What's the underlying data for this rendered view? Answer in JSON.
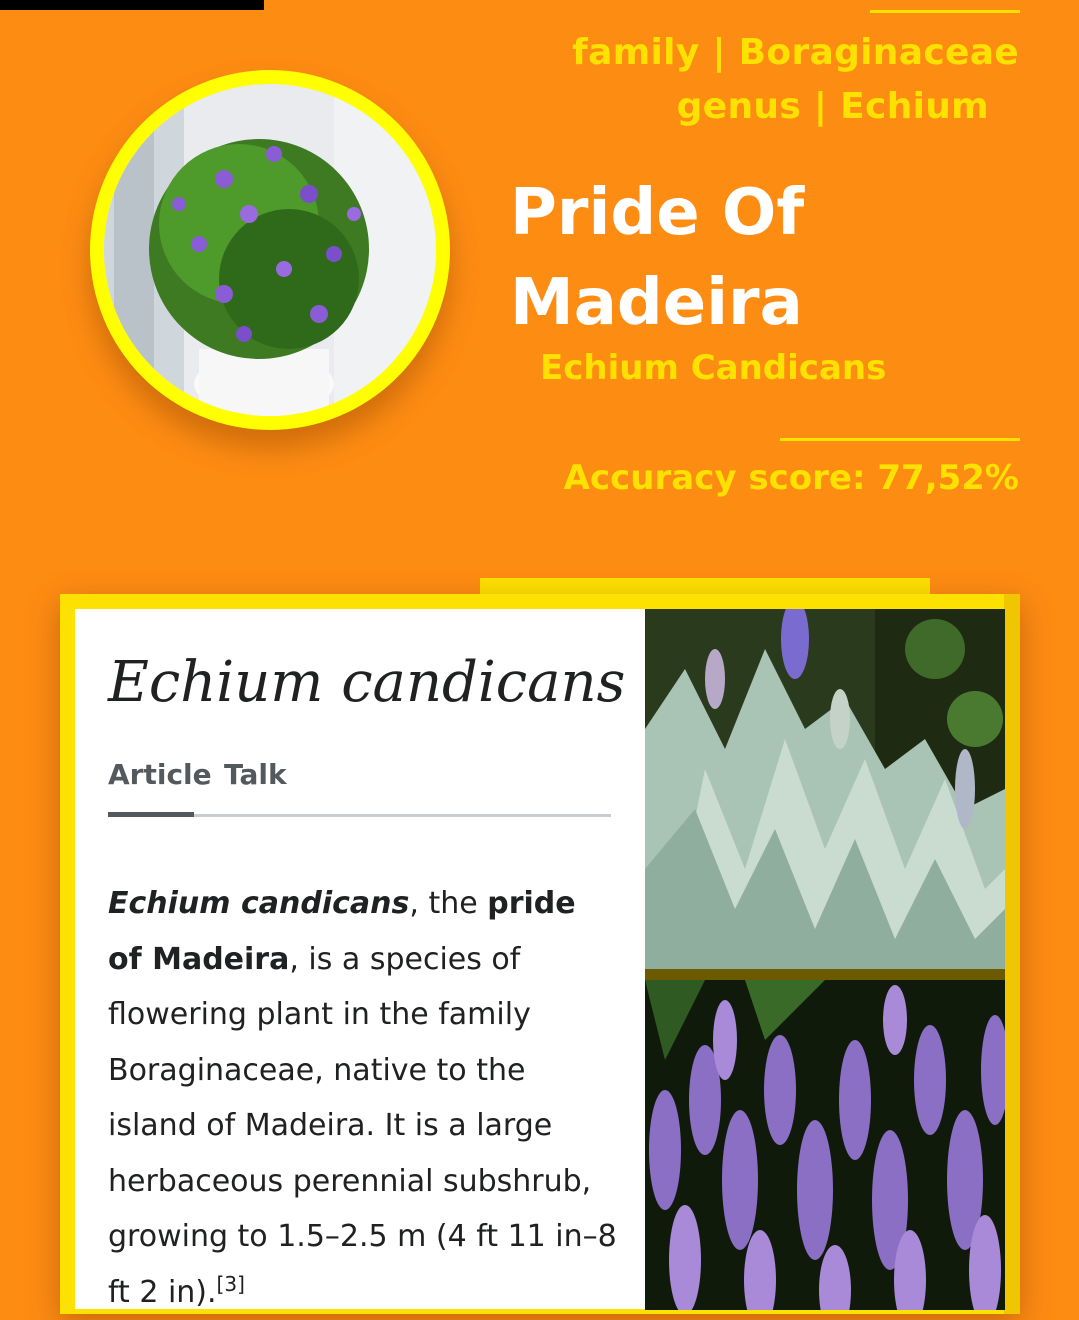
{
  "taxonomy": {
    "family": "family | Boraginaceae",
    "genus": "genus | Echium"
  },
  "plant": {
    "common_name": "Pride Of Madeira",
    "scientific_name": "Echium Candicans",
    "accuracy": "Accuracy score: 77,52%"
  },
  "article": {
    "title": "Echium candicans",
    "tabs": [
      "Article",
      "Talk"
    ],
    "body": {
      "bold_italic_name": "Echium candicans",
      "text_1": ", the ",
      "bold_common": "pride of Madeira",
      "text_2": ", is a species of flowering plant in the family Boraginaceae, native to the island of Madeira. It is a large herbaceous perennial subshrub, growing to 1.5–2.5 m (4 ft 11 in–8 ft 2 in).",
      "citation": "[3]"
    }
  },
  "colors": {
    "background": "#fd8c13",
    "accent": "#fde100",
    "ring": "#ffff00"
  }
}
